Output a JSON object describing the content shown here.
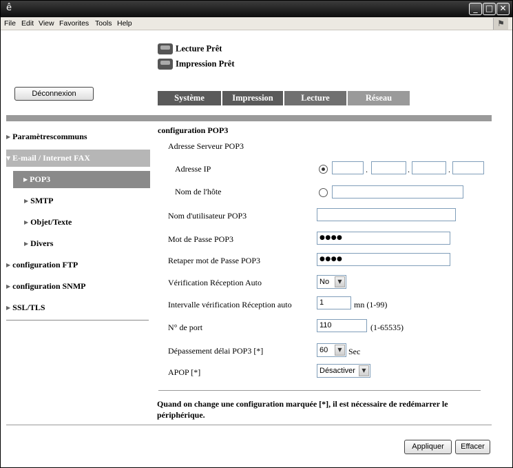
{
  "menu": [
    "File",
    "Edit",
    "View",
    "Favorites",
    "Tools",
    "Help"
  ],
  "status": {
    "scan": "Lecture Prêt",
    "print": "Impression Prêt"
  },
  "logout_label": "Déconnexion",
  "tabs": [
    {
      "label": "Système",
      "color": "#5a5a5a"
    },
    {
      "label": "Impression",
      "color": "#5a5a5a"
    },
    {
      "label": "Lecture",
      "color": "#707070"
    },
    {
      "label": "Réseau",
      "color": "#9a9a9a"
    }
  ],
  "sidebar": {
    "items": [
      {
        "label": "Paramètrescommuns",
        "arrow": "▶"
      },
      {
        "label": "E-mail / Internet FAX",
        "arrow": "▼"
      },
      {
        "label": "POP3",
        "arrow": "▶"
      },
      {
        "label": "SMTP",
        "arrow": "▶"
      },
      {
        "label": "Objet/Texte",
        "arrow": "▶"
      },
      {
        "label": "Divers",
        "arrow": "▶"
      },
      {
        "label": "configuration FTP",
        "arrow": "▶"
      },
      {
        "label": "configuration SNMP",
        "arrow": "▶"
      },
      {
        "label": "SSL/TLS",
        "arrow": "▶"
      }
    ]
  },
  "form": {
    "title": "configuration POP3",
    "server_label": "Adresse Serveur POP3",
    "ip_label": "Adresse IP",
    "ip_dot": ".",
    "host_label": "Nom de l'hôte",
    "user_label": "Nom d'utilisateur POP3",
    "user_value": "",
    "password_label": "Mot de Passe POP3",
    "password_value": "●●●●",
    "retype_label": "Retaper mot de Passe POP3",
    "retype_value": "●●●●",
    "auto_check_label": "Vérification Réception Auto",
    "auto_check_value": "No",
    "interval_label": "Intervalle vérification Réception auto",
    "interval_value": "1",
    "interval_unit": "mn (1-99)",
    "port_label": "N° de port",
    "port_value": "110",
    "port_range": "(1-65535)",
    "timeout_label": "Dépassement délai POP3 [*]",
    "timeout_value": "60",
    "timeout_unit": "Sec",
    "apop_label": "APOP [*]",
    "apop_value": "Désactiver",
    "note": "Quand on change une configuration marquée [*], il est nécessaire de redémarrer le périphérique."
  },
  "buttons": {
    "apply": "Appliquer",
    "clear": "Effacer"
  }
}
